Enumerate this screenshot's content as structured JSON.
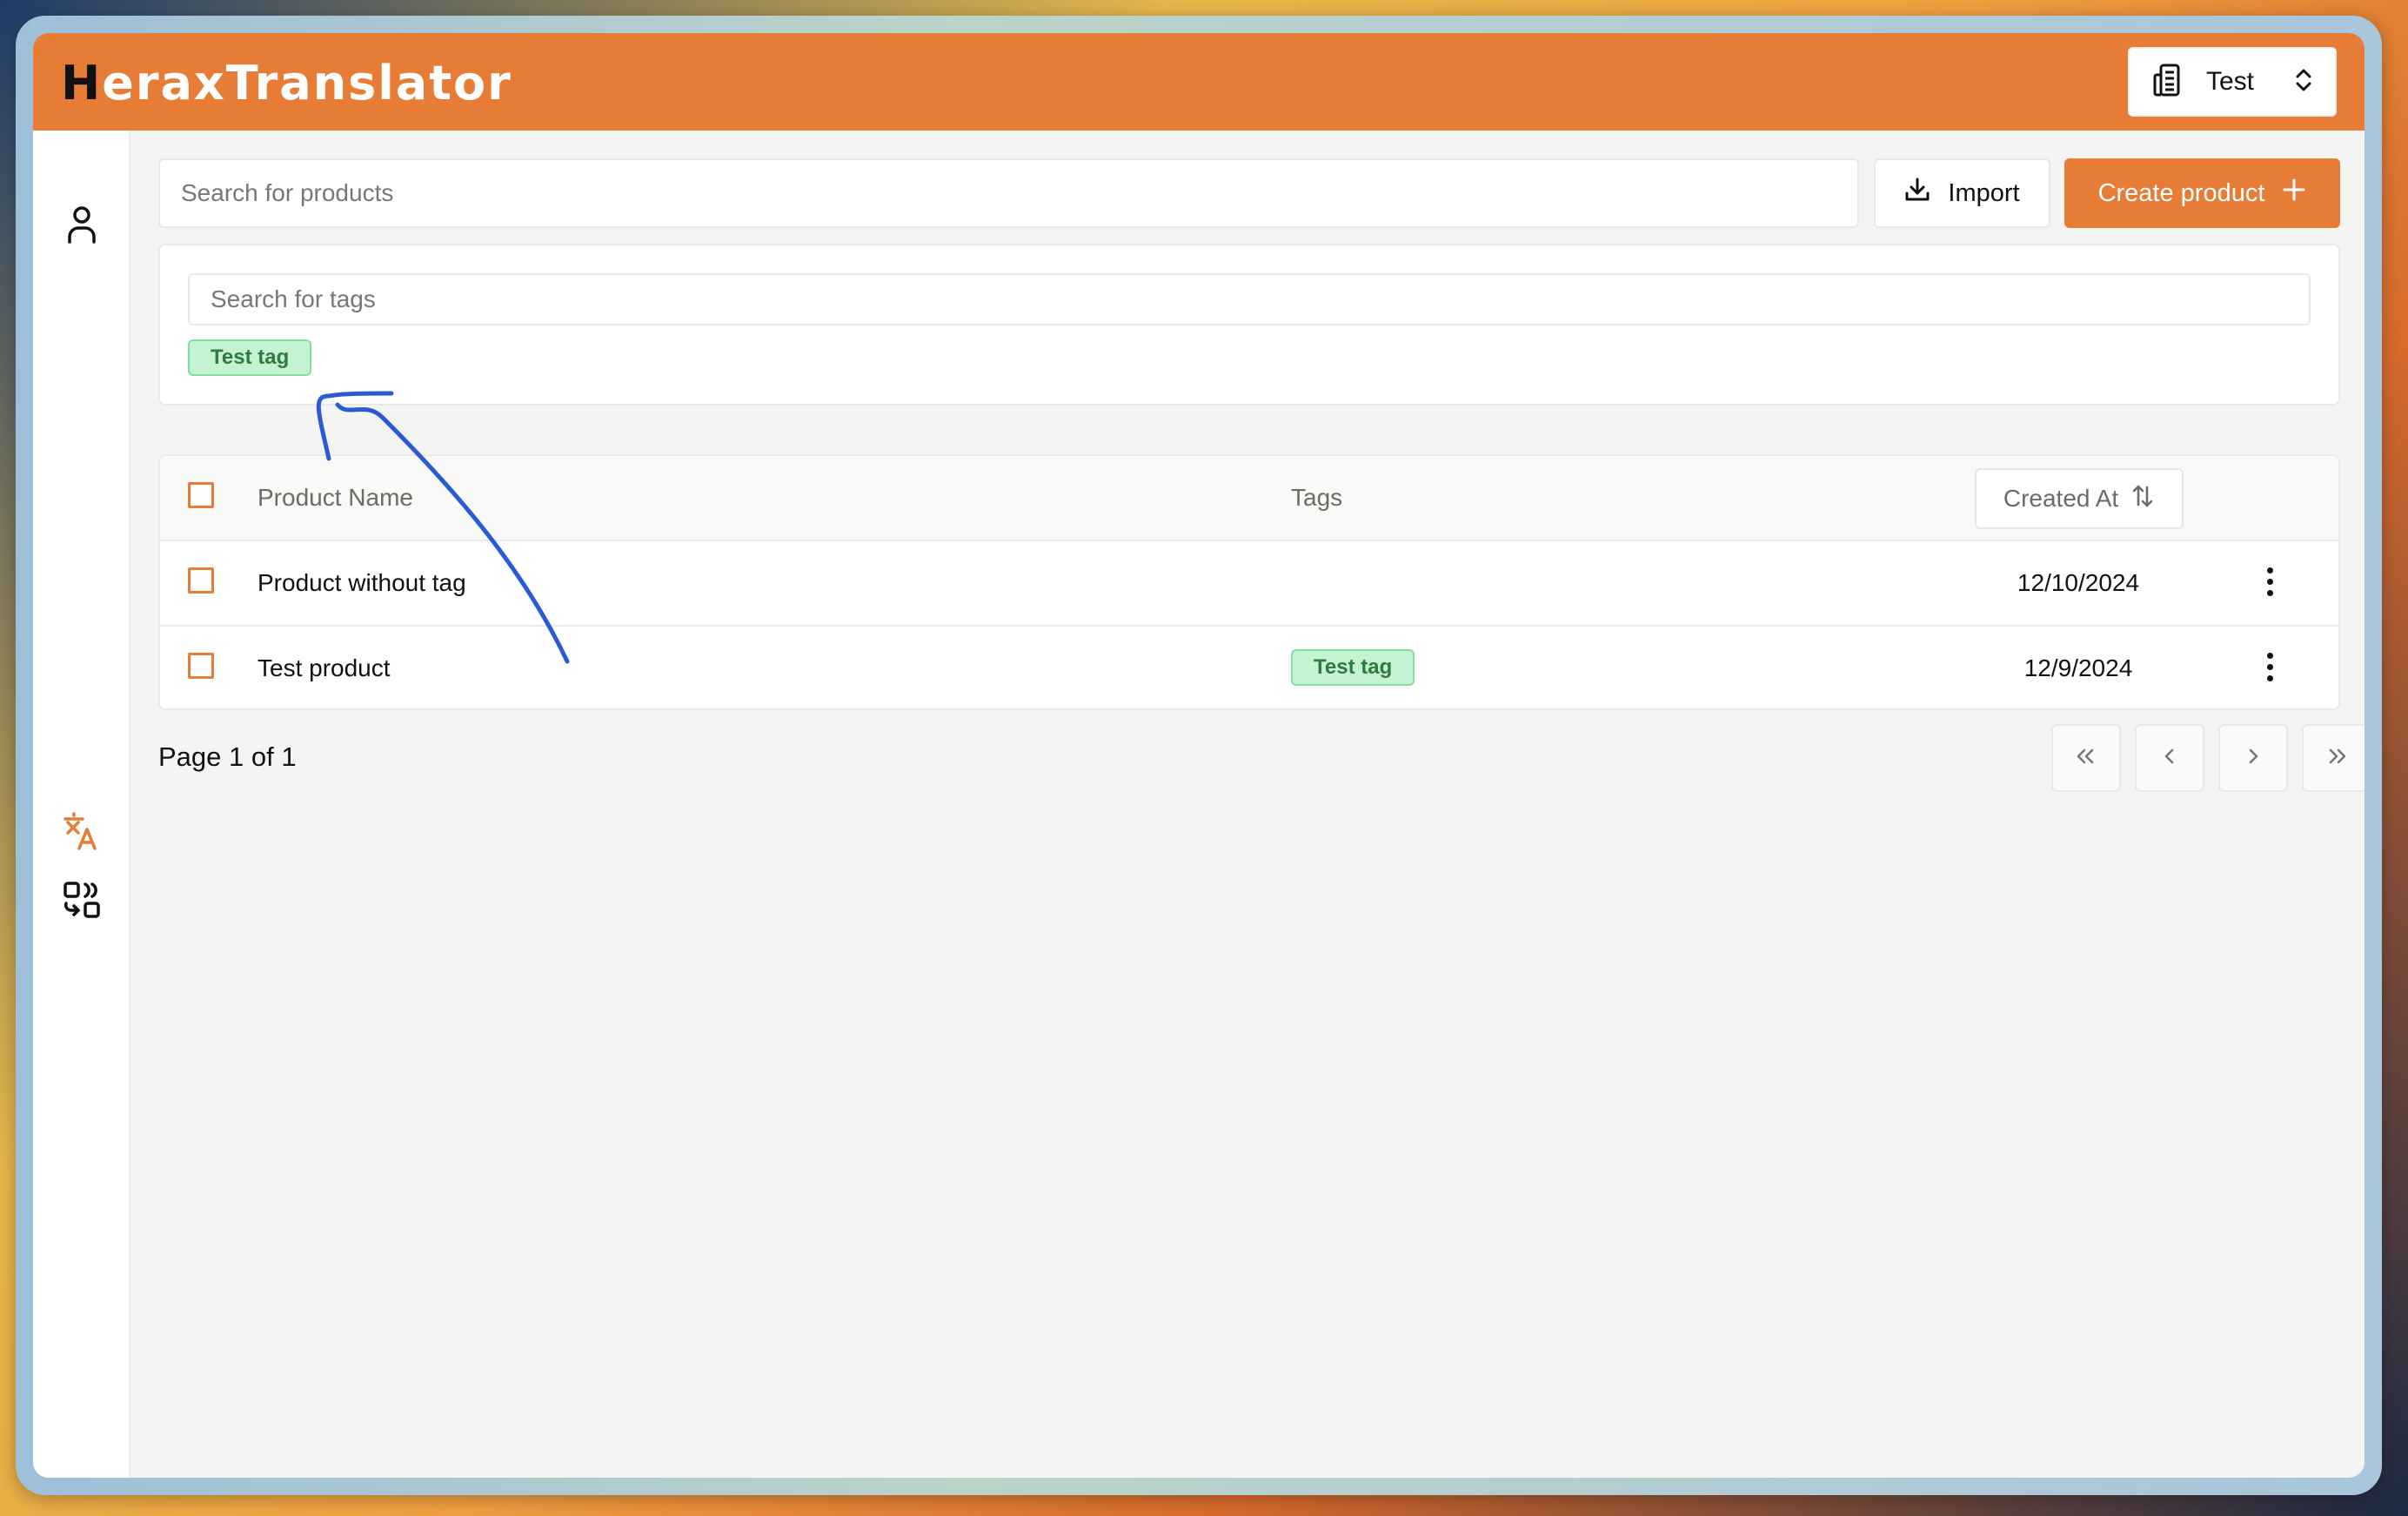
{
  "header": {
    "logo_initial": "H",
    "logo_rest": "eraxTranslator",
    "org_selector": {
      "label": "Test",
      "icon": "building-icon",
      "chevron": "chevron-up-down-icon"
    }
  },
  "sidebar": {
    "items": [
      {
        "name": "profile",
        "icon": "user-icon"
      },
      {
        "name": "translations",
        "icon": "translate-icon",
        "active": true
      },
      {
        "name": "products",
        "icon": "products-icon"
      }
    ]
  },
  "toolbar": {
    "search_placeholder": "Search for products",
    "search_value": "",
    "import_label": "Import",
    "create_label": "Create product"
  },
  "tags_filter": {
    "search_placeholder": "Search for tags",
    "tags": [
      "Test tag"
    ]
  },
  "table": {
    "columns": {
      "name": "Product Name",
      "tags": "Tags",
      "created": "Created At"
    },
    "rows": [
      {
        "name": "Product without tag",
        "tags": [],
        "created": "12/10/2024"
      },
      {
        "name": "Test product",
        "tags": [
          "Test tag"
        ],
        "created": "12/9/2024"
      }
    ]
  },
  "pagination": {
    "label": "Page 1 of 1",
    "current": 1,
    "total": 1,
    "buttons": [
      "first",
      "previous",
      "next",
      "last"
    ]
  },
  "colors": {
    "accent": "#e77c37",
    "tag_bg": "#c6f2d4",
    "tag_border": "#86dc9c",
    "tag_text": "#2f7a43",
    "annotation": "#2a5bd7"
  }
}
